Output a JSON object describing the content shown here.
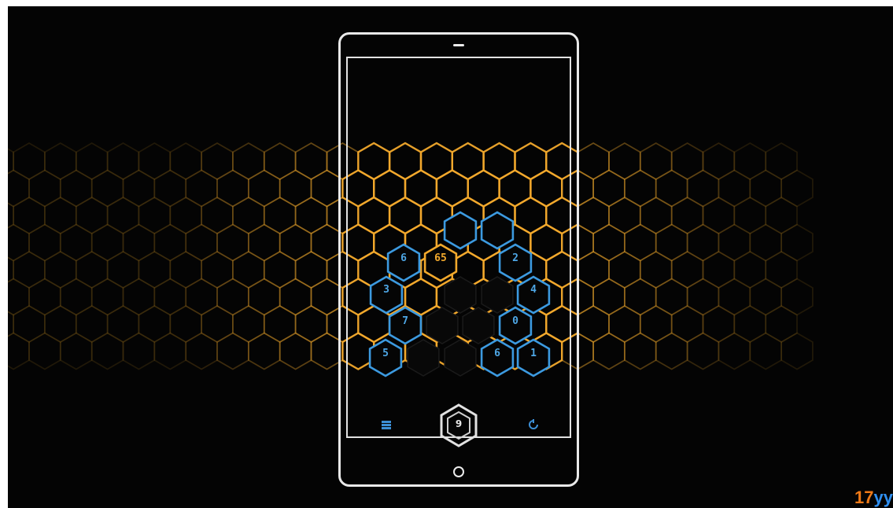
{
  "game": {
    "numbers": [
      {
        "id": "n6a",
        "text": "6",
        "kind": "blue"
      },
      {
        "id": "n65",
        "text": "65",
        "kind": "gold"
      },
      {
        "id": "n2",
        "text": "2",
        "kind": "blue"
      },
      {
        "id": "n3",
        "text": "3",
        "kind": "blue"
      },
      {
        "id": "n4",
        "text": "4",
        "kind": "blue"
      },
      {
        "id": "n7",
        "text": "7",
        "kind": "blue"
      },
      {
        "id": "n0",
        "text": "0",
        "kind": "blue"
      },
      {
        "id": "n5",
        "text": "5",
        "kind": "blue"
      },
      {
        "id": "n6b",
        "text": "6",
        "kind": "blue"
      },
      {
        "id": "n1",
        "text": "1",
        "kind": "blue"
      }
    ],
    "controls": {
      "menu_icon": "menu-icon",
      "center_value": "9",
      "restart_icon": "restart-icon"
    }
  },
  "colors": {
    "background": "#040404",
    "gold": "#f2a92c",
    "blue": "#3c9ae0",
    "phone_outline": "#e9e9e9"
  },
  "watermark": {
    "part1": "17",
    "part2": "yy"
  }
}
